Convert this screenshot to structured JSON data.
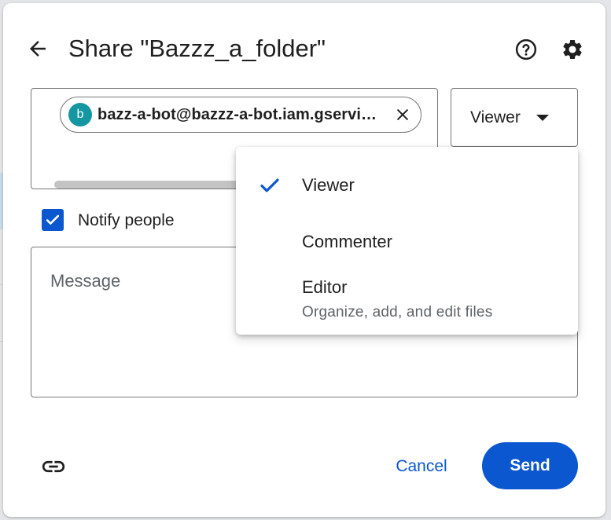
{
  "dialog": {
    "title": "Share \"Bazzz_a_folder\"",
    "icons": {
      "back": "arrow-back-icon",
      "help": "help-circle-icon",
      "settings": "gear-icon"
    }
  },
  "recipients": {
    "chips": [
      {
        "initial": "b",
        "email": "bazz-a-bot@bazzz-a-bot.iam.gservi…",
        "avatar_color": "#1597a2"
      }
    ]
  },
  "role_select": {
    "selected": "Viewer"
  },
  "role_menu": {
    "items": [
      {
        "label": "Viewer",
        "description": "",
        "selected": true
      },
      {
        "label": "Commenter",
        "description": "",
        "selected": false
      },
      {
        "label": "Editor",
        "description": "Organize, add, and edit files",
        "selected": false
      }
    ]
  },
  "notify": {
    "label": "Notify people",
    "checked": true
  },
  "message": {
    "placeholder": "Message",
    "value": ""
  },
  "footer": {
    "cancel_label": "Cancel",
    "send_label": "Send",
    "link_icon": "link-icon"
  },
  "colors": {
    "primary": "#0b57d0",
    "text": "#1f1f1f",
    "muted": "#5f6368",
    "border": "#747775"
  }
}
